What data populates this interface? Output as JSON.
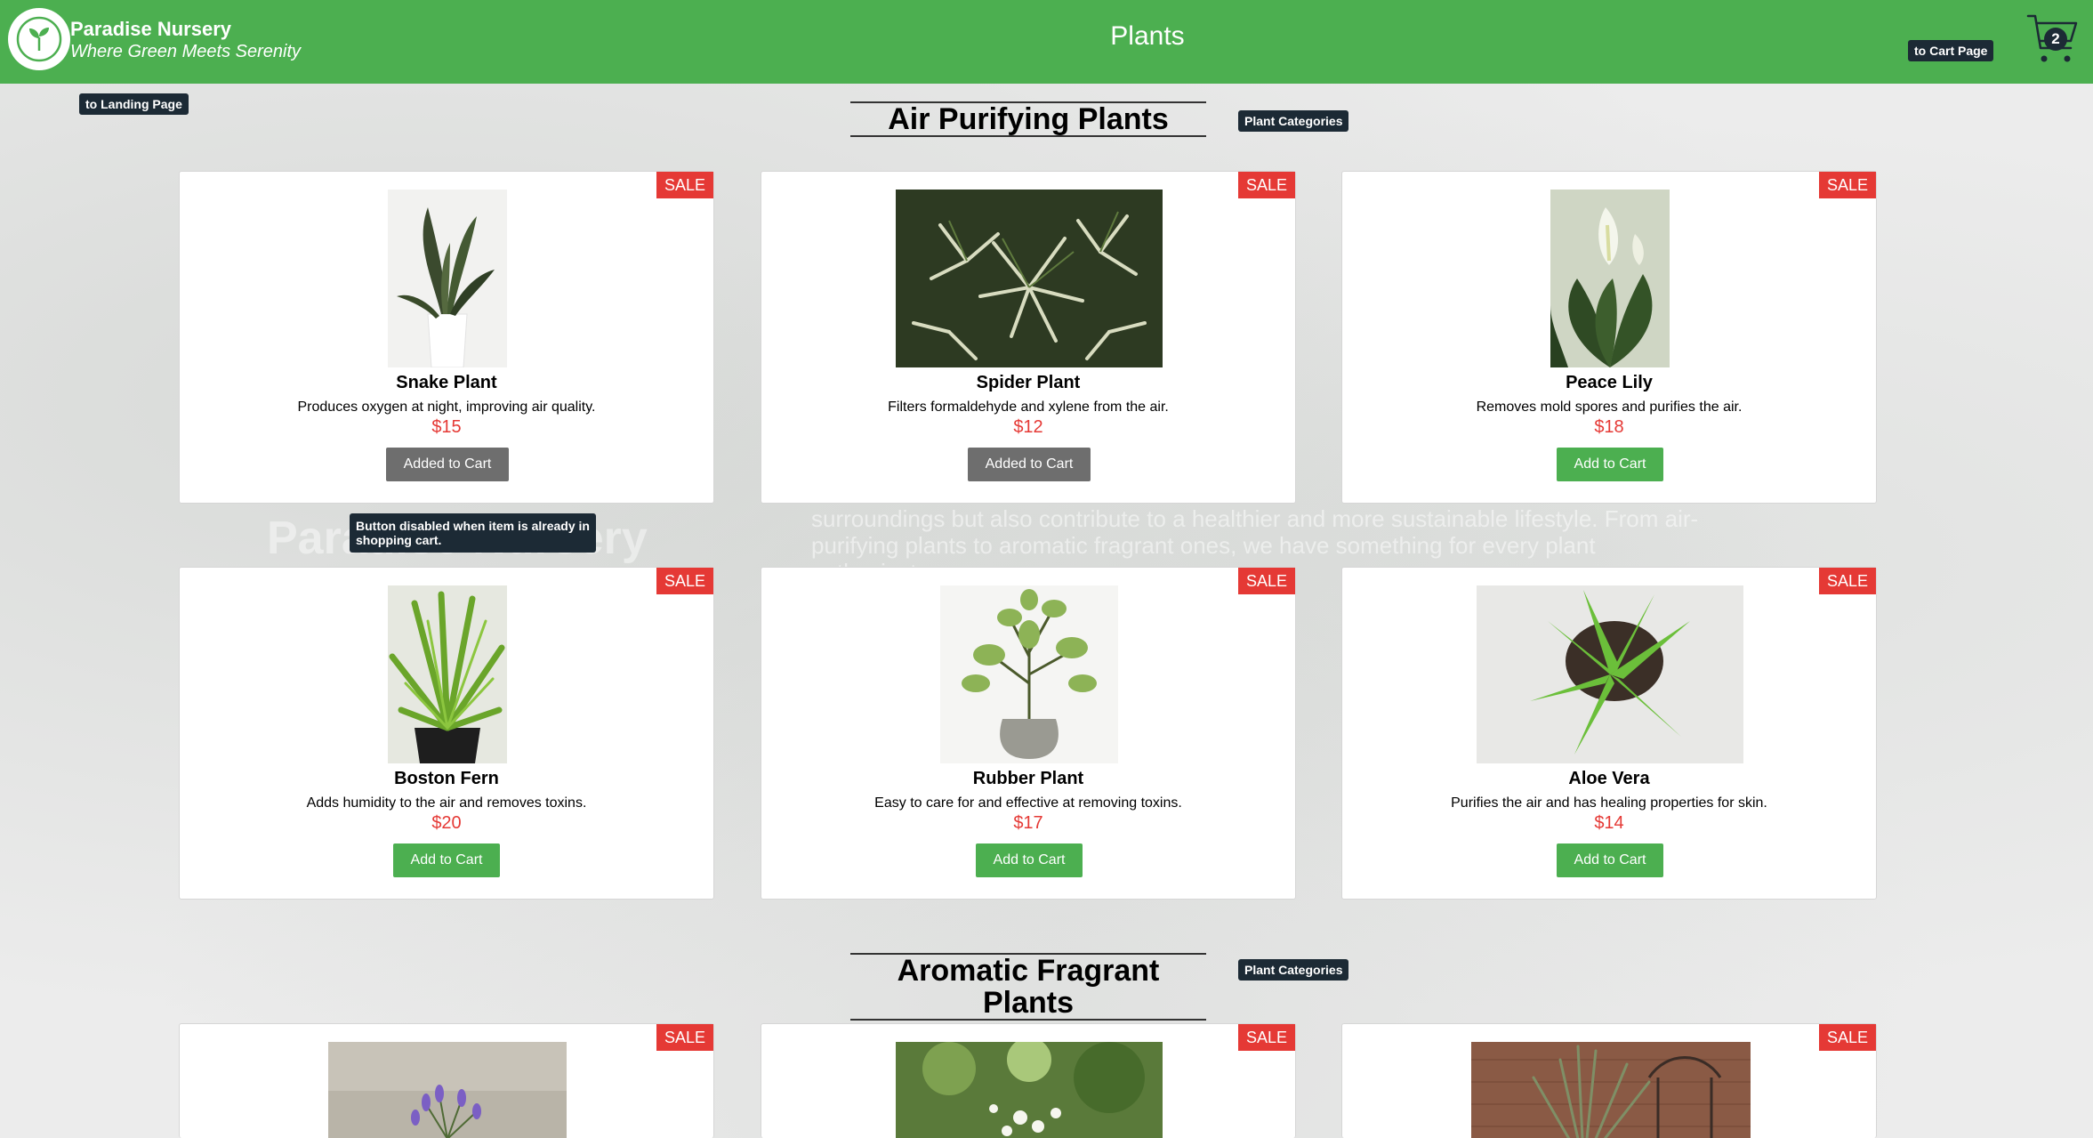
{
  "header": {
    "brand_name": "Paradise Nursery",
    "brand_tagline": "Where Green Meets Serenity",
    "nav_title": "Plants",
    "cart_count": "2"
  },
  "background": {
    "ghost_heading": "Paradise Nursery",
    "ghost_paragraph": "surroundings but also contribute to a healthier and more sustainable lifestyle. From air-purifying plants to aromatic fragrant ones, we have something for every plant enthusiast."
  },
  "tooltips": {
    "landing": "to Landing Page",
    "cart_page": "to Cart Page",
    "category_1": "Plant Categories",
    "category_2": "Plant Categories",
    "disabled_button": "Button disabled when item is already in shopping cart."
  },
  "sections": [
    {
      "title": "Air Purifying Plants",
      "plants": [
        {
          "name": "Snake Plant",
          "description": "Produces oxygen at night, improving air quality.",
          "price": "$15",
          "sale": "SALE",
          "button": "Added to Cart",
          "in_cart": true
        },
        {
          "name": "Spider Plant",
          "description": "Filters formaldehyde and xylene from the air.",
          "price": "$12",
          "sale": "SALE",
          "button": "Added to Cart",
          "in_cart": true
        },
        {
          "name": "Peace Lily",
          "description": "Removes mold spores and purifies the air.",
          "price": "$18",
          "sale": "SALE",
          "button": "Add to Cart",
          "in_cart": false
        },
        {
          "name": "Boston Fern",
          "description": "Adds humidity to the air and removes toxins.",
          "price": "$20",
          "sale": "SALE",
          "button": "Add to Cart",
          "in_cart": false
        },
        {
          "name": "Rubber Plant",
          "description": "Easy to care for and effective at removing toxins.",
          "price": "$17",
          "sale": "SALE",
          "button": "Add to Cart",
          "in_cart": false
        },
        {
          "name": "Aloe Vera",
          "description": "Purifies the air and has healing properties for skin.",
          "price": "$14",
          "sale": "SALE",
          "button": "Add to Cart",
          "in_cart": false
        }
      ]
    },
    {
      "title": "Aromatic Fragrant Plants",
      "plants": [
        {
          "sale": "SALE"
        },
        {
          "sale": "SALE"
        },
        {
          "sale": "SALE"
        }
      ]
    }
  ],
  "colors": {
    "header_green": "#4caf50",
    "sale_red": "#e53935",
    "price_red": "#e53935",
    "disabled_gray": "#6e6e6e",
    "tooltip_navy": "#1c2a35"
  }
}
